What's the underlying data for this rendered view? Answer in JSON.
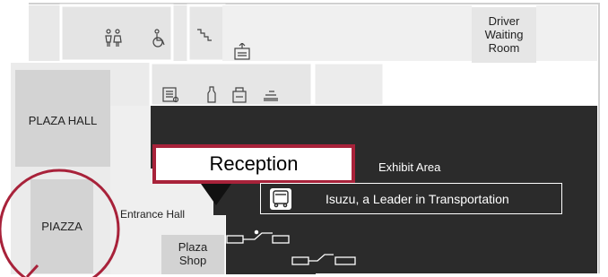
{
  "colors": {
    "room_fill": "#e6e6e6",
    "gray_block": "#d3d3d3",
    "dark_area": "#2b2b2b",
    "accent_red": "#a8223a"
  },
  "rooms": {
    "driver_waiting": "Driver\nWaiting\nRoom",
    "plaza_hall": "PLAZA HALL",
    "piazza": "PIAZZA",
    "entrance_hall": "Entrance Hall",
    "plaza_shop": "Plaza\nShop",
    "exhibit_area": "Exhibit Area"
  },
  "callout": {
    "label": "Reception"
  },
  "banner": {
    "label": "Isuzu, a Leader in Transportation"
  },
  "icons": [
    "restroom-icon",
    "accessible-restroom-icon",
    "stairs-icon",
    "elevator-icon",
    "vending-machine-icon",
    "bottle-icon",
    "coin-locker-icon",
    "luggage-icon",
    "bus-icon",
    "escalator-up-icon",
    "escalator-down-icon"
  ]
}
